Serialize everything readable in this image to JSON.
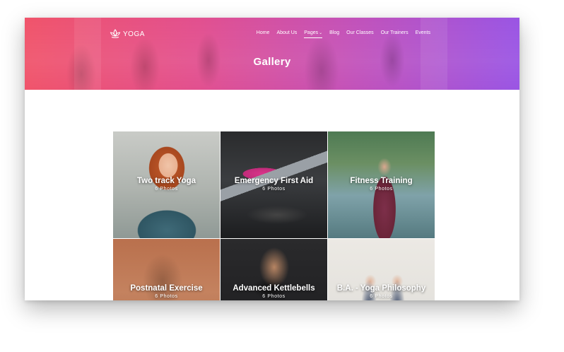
{
  "brand": {
    "name": "YOGA",
    "logo_icon": "lotus-icon"
  },
  "nav": {
    "items": [
      {
        "label": "Home"
      },
      {
        "label": "About Us"
      },
      {
        "label": "Pages",
        "active": true,
        "has_dropdown": true,
        "caret": "⌄"
      },
      {
        "label": "Blog"
      },
      {
        "label": "Our Classes"
      },
      {
        "label": "Our Trainers"
      },
      {
        "label": "Events"
      }
    ]
  },
  "page": {
    "title": "Gallery"
  },
  "gallery": {
    "items": [
      {
        "title": "Two track Yoga",
        "count": "6 Photos"
      },
      {
        "title": "Emergency First Aid",
        "count": "6 Photos"
      },
      {
        "title": "Fitness Training",
        "count": "6 Photos"
      },
      {
        "title": "Postnatal Exercise",
        "count": "6 Photos"
      },
      {
        "title": "Advanced Kettlebells",
        "count": "6 Photos"
      },
      {
        "title": "B.A. - Yoga Philosophy",
        "count": "6 Photos"
      }
    ]
  },
  "colors": {
    "hero_gradient_start": "#f0546b",
    "hero_gradient_end": "#9a55e4",
    "text_on_hero": "#ffffff"
  }
}
